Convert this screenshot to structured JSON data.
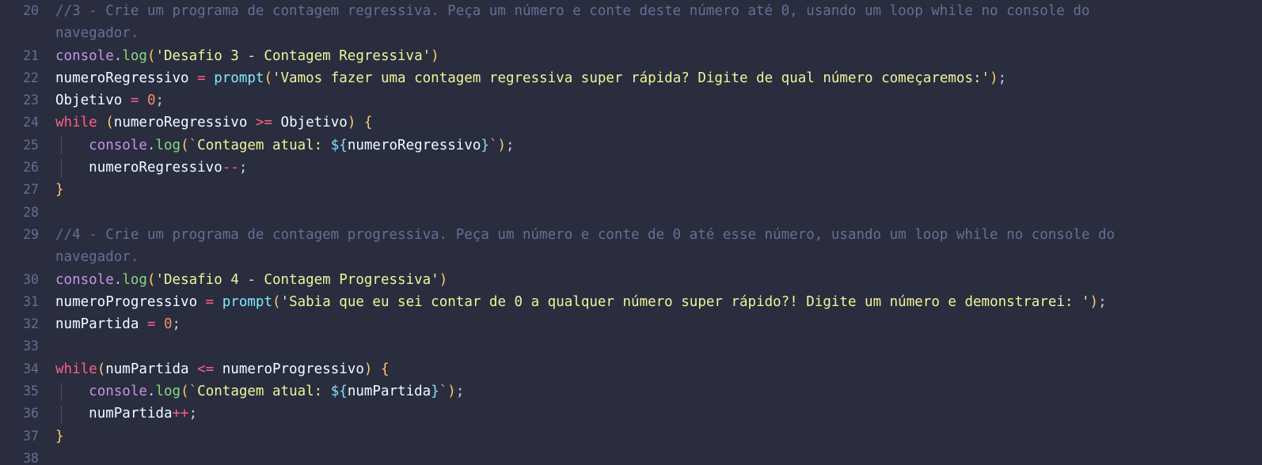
{
  "editor": {
    "app": "code-editor",
    "language": "javascript",
    "theme": "material-palenight",
    "background_color": "#292d3e",
    "gutter_color": "#676e95",
    "indent_guide_color": "#4b5263",
    "first_visible_line": 20,
    "last_visible_line": 38
  },
  "colors": {
    "comment": "#676e95",
    "object": "#c792ea",
    "function": "#82d982",
    "paren": "#ffcb6b",
    "string": "#f0f49a",
    "keyword": "#ff5f87",
    "operator": "#ff5f87",
    "variable": "#eeffff",
    "builtin": "#82e9ff",
    "number": "#f78c6c",
    "template_delim": "#89ddff",
    "punctuation": "#c3cee3"
  },
  "lines": [
    {
      "number": "20",
      "kind": "comment",
      "wrapped": true,
      "text": "//3 - Crie um programa de contagem regressiva. Peça um número e conte deste número até 0, usando um loop while no console do navegador.",
      "part1": "//3 - Crie um programa de contagem regressiva. Peça um número e conte deste número até 0, usando um loop while no console do",
      "part2": "navegador."
    },
    {
      "number": "21",
      "kind": "code",
      "text": "console.log('Desafio 3 - Contagem Regressiva')",
      "tokens": {
        "object": "console",
        "dot": ".",
        "method": "log",
        "open_paren": "(",
        "string": "'Desafio 3 - Contagem Regressiva'",
        "close_paren": ")"
      }
    },
    {
      "number": "22",
      "kind": "code",
      "text": "numeroRegressivo = prompt('Vamos fazer uma contagem regressiva super rápida? Digite de qual número começaremos:');",
      "tokens": {
        "variable": "numeroRegressivo",
        "equals": "=",
        "builtin": "prompt",
        "open_paren": "(",
        "string": "'Vamos fazer uma contagem regressiva super rápida? Digite de qual número começaremos:'",
        "close_paren": ")",
        "semicolon": ";"
      }
    },
    {
      "number": "23",
      "kind": "code",
      "text": "Objetivo = 0;",
      "tokens": {
        "variable": "Objetivo",
        "equals": "=",
        "number": "0",
        "semicolon": ";"
      }
    },
    {
      "number": "24",
      "kind": "code",
      "text": "while (numeroRegressivo >= Objetivo) {",
      "tokens": {
        "keyword": "while",
        "open_paren": "(",
        "variable": "numeroRegressivo",
        "operator": ">=",
        "variable2": "Objetivo",
        "close_paren": ")",
        "open_brace": "{"
      }
    },
    {
      "number": "25",
      "kind": "code",
      "indent": 1,
      "text": "    console.log(`Contagem atual: ${numeroRegressivo}`);",
      "tokens": {
        "object": "console",
        "dot": ".",
        "method": "log",
        "open_paren": "(",
        "backtick_open": "`",
        "string": "Contagem atual: ",
        "interp_open": "${",
        "variable": "numeroRegressivo",
        "interp_close": "}",
        "backtick_close": "`",
        "close_paren": ")",
        "semicolon": ";"
      }
    },
    {
      "number": "26",
      "kind": "code",
      "indent": 1,
      "text": "    numeroRegressivo--;",
      "tokens": {
        "variable": "numeroRegressivo",
        "operator": "--",
        "semicolon": ";"
      }
    },
    {
      "number": "27",
      "kind": "code",
      "text": "}",
      "tokens": {
        "close_brace": "}"
      }
    },
    {
      "number": "28",
      "kind": "blank",
      "text": ""
    },
    {
      "number": "29",
      "kind": "comment",
      "wrapped": true,
      "text": "//4 - Crie um programa de contagem progressiva. Peça um número e conte de 0 até esse número, usando um loop while no console do navegador.",
      "part1": "//4 - Crie um programa de contagem progressiva. Peça um número e conte de 0 até esse número, usando um loop while no console do",
      "part2": "navegador."
    },
    {
      "number": "30",
      "kind": "code",
      "text": "console.log('Desafio 4 - Contagem Progressiva')",
      "tokens": {
        "object": "console",
        "dot": ".",
        "method": "log",
        "open_paren": "(",
        "string": "'Desafio 4 - Contagem Progressiva'",
        "close_paren": ")"
      }
    },
    {
      "number": "31",
      "kind": "code",
      "text": "numeroProgressivo = prompt('Sabia que eu sei contar de 0 a qualquer número super rápido?! Digite um número e demonstrarei: ');",
      "tokens": {
        "variable": "numeroProgressivo",
        "equals": "=",
        "builtin": "prompt",
        "open_paren": "(",
        "string": "'Sabia que eu sei contar de 0 a qualquer número super rápido?! Digite um número e demonstrarei: '",
        "close_paren": ")",
        "semicolon": ";"
      }
    },
    {
      "number": "32",
      "kind": "code",
      "text": "numPartida = 0;",
      "tokens": {
        "variable": "numPartida",
        "equals": "=",
        "number": "0",
        "semicolon": ";"
      }
    },
    {
      "number": "33",
      "kind": "blank",
      "text": ""
    },
    {
      "number": "34",
      "kind": "code",
      "text": "while(numPartida <= numeroProgressivo) {",
      "tokens": {
        "keyword": "while",
        "open_paren": "(",
        "variable": "numPartida",
        "operator": "<=",
        "variable2": "numeroProgressivo",
        "close_paren": ")",
        "open_brace": "{"
      }
    },
    {
      "number": "35",
      "kind": "code",
      "indent": 1,
      "text": "    console.log(`Contagem atual: ${numPartida}`);",
      "tokens": {
        "object": "console",
        "dot": ".",
        "method": "log",
        "open_paren": "(",
        "backtick_open": "`",
        "string": "Contagem atual: ",
        "interp_open": "${",
        "variable": "numPartida",
        "interp_close": "}",
        "backtick_close": "`",
        "close_paren": ")",
        "semicolon": ";"
      }
    },
    {
      "number": "36",
      "kind": "code",
      "indent": 1,
      "text": "    numPartida++;",
      "tokens": {
        "variable": "numPartida",
        "operator": "++",
        "semicolon": ";"
      }
    },
    {
      "number": "37",
      "kind": "code",
      "text": "}",
      "tokens": {
        "close_brace": "}"
      }
    },
    {
      "number": "38",
      "kind": "blank",
      "text": ""
    }
  ]
}
